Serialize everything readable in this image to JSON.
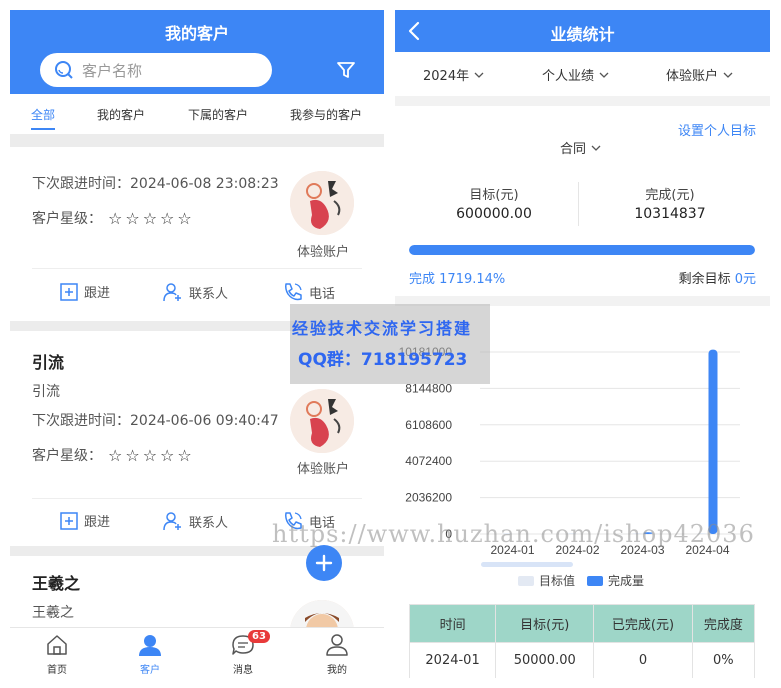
{
  "left": {
    "header": {
      "title": "我的客户",
      "search_placeholder": "客户名称"
    },
    "tabs": [
      {
        "label": "全部"
      },
      {
        "label": "我的客户"
      },
      {
        "label": "下属的客户"
      },
      {
        "label": "我参与的客户"
      }
    ],
    "cards": [
      {
        "name": "",
        "source": "",
        "next_follow": "下次跟进时间：2024-06-08 23:08:23",
        "stars_label": "客户星级：",
        "account": "体验账户"
      },
      {
        "name": "引流",
        "source": "引流",
        "next_follow": "下次跟进时间：2024-06-06 09:40:47",
        "stars_label": "客户星级：",
        "account": "体验账户"
      },
      {
        "name": "王羲之",
        "source": "王羲之"
      }
    ],
    "actions": {
      "follow": "跟进",
      "contact": "联系人",
      "phone": "电话"
    },
    "bottom_nav": [
      {
        "label": "首页"
      },
      {
        "label": "客户"
      },
      {
        "label": "消息",
        "badge": "63"
      },
      {
        "label": "我的"
      }
    ]
  },
  "right": {
    "header": {
      "title": "业绩统计"
    },
    "filters": {
      "year": "2024年",
      "scope": "个人业绩",
      "account": "体验账户"
    },
    "panel": {
      "link": "设置个人目标",
      "contract": "合同",
      "target_label": "目标(元)",
      "target_value": "600000.00",
      "done_label": "完成(元)",
      "done_value": "10314837",
      "progress": 1.0,
      "done_prefix": "完成",
      "done_pct": "1719.14%",
      "remain_prefix": "剩余目标",
      "remain_value": "0元"
    },
    "legend": {
      "target": "目标值",
      "done": "完成量"
    },
    "table": {
      "headers": [
        "时间",
        "目标(元)",
        "已完成(元)",
        "完成度"
      ],
      "rows": [
        [
          "2024-01",
          "50000.00",
          "0",
          "0%"
        ]
      ]
    }
  },
  "chart_data": {
    "type": "bar",
    "categories": [
      "2024-01",
      "2024-02",
      "2024-03",
      "2024-04"
    ],
    "series": [
      {
        "name": "目标值",
        "values": [
          50000,
          50000,
          50000,
          50000
        ]
      },
      {
        "name": "完成量",
        "values": [
          0,
          0,
          95000,
          10314837
        ]
      }
    ],
    "yticks": [
      "0",
      "2036200",
      "4072400",
      "6108600",
      "8144800",
      "10181000"
    ],
    "ylim": [
      0,
      10181000
    ],
    "legend": "bottom",
    "colors": {
      "target": "#e3e9f3",
      "done": "#3d86f5"
    }
  },
  "watermark": {
    "line1": "经验技术交流学习搭建",
    "line2": "QQ群：718195723",
    "url": "https://www.huzhan.com/ishop42036"
  }
}
